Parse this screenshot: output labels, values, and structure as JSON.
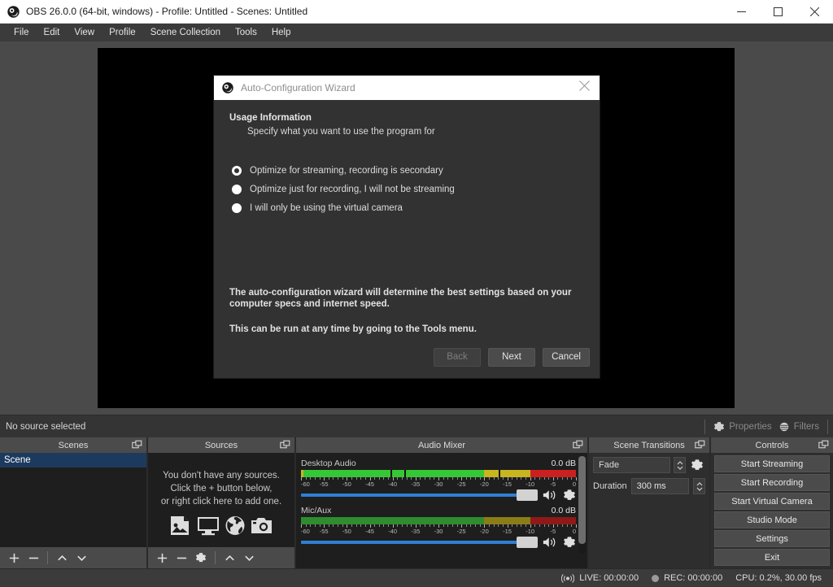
{
  "window": {
    "title": "OBS 26.0.0 (64-bit, windows) - Profile: Untitled - Scenes: Untitled",
    "minimize_label": "Minimize",
    "maximize_label": "Maximize",
    "close_label": "Close"
  },
  "menubar": {
    "items": [
      {
        "label": "File"
      },
      {
        "label": "Edit"
      },
      {
        "label": "View"
      },
      {
        "label": "Profile"
      },
      {
        "label": "Scene Collection"
      },
      {
        "label": "Tools"
      },
      {
        "label": "Help"
      }
    ]
  },
  "source_toolbar": {
    "status": "No source selected",
    "properties_label": "Properties",
    "filters_label": "Filters"
  },
  "scenes": {
    "title": "Scenes",
    "items": [
      {
        "name": "Scene",
        "selected": true
      }
    ]
  },
  "sources": {
    "title": "Sources",
    "empty_lines": [
      "You don't have any sources.",
      "Click the + button below,",
      "or right click here to add one."
    ]
  },
  "audio_mixer": {
    "title": "Audio Mixer",
    "tick_labels": [
      "-60",
      "-55",
      "-50",
      "-45",
      "-40",
      "-35",
      "-30",
      "-25",
      "-20",
      "-15",
      "-10",
      "-5",
      "0"
    ],
    "channels": [
      {
        "name": "Desktop Audio",
        "db": "0.0 dB",
        "active": true,
        "level_pct": 49,
        "peak_pct": 51,
        "volume_pct": 100
      },
      {
        "name": "Mic/Aux",
        "db": "0.0 dB",
        "active": false,
        "level_pct": 0,
        "peak_pct": 0,
        "volume_pct": 100
      }
    ]
  },
  "scene_transitions": {
    "title": "Scene Transitions",
    "transition": "Fade",
    "duration_label": "Duration",
    "duration_value": "300 ms"
  },
  "controls": {
    "title": "Controls",
    "buttons": [
      {
        "label": "Start Streaming"
      },
      {
        "label": "Start Recording"
      },
      {
        "label": "Start Virtual Camera"
      },
      {
        "label": "Studio Mode"
      },
      {
        "label": "Settings"
      },
      {
        "label": "Exit"
      }
    ]
  },
  "statusbar": {
    "live_label": "LIVE: 00:00:00",
    "rec_label": "REC: 00:00:00",
    "cpu_label": "CPU: 0.2%, 30.00 fps"
  },
  "wizard": {
    "title": "Auto-Configuration Wizard",
    "heading": "Usage Information",
    "subheading": "Specify what you want to use the program for",
    "options": [
      {
        "label": "Optimize for streaming, recording is secondary",
        "selected": true
      },
      {
        "label": "Optimize just for recording, I will not be streaming",
        "selected": false
      },
      {
        "label": "I will only be using the virtual camera",
        "selected": false
      }
    ],
    "paragraph1": "The auto-configuration wizard will determine the best settings based on your computer specs and internet speed.",
    "paragraph2": "This can be run at any time by going to the Tools menu.",
    "back_label": "Back",
    "next_label": "Next",
    "cancel_label": "Cancel",
    "back_disabled": true
  },
  "colors": {
    "accent_blue": "#2f7fd4",
    "selection_blue": "#1c3a5e",
    "meter_green": "#36c736",
    "meter_yellow": "#c8b520",
    "meter_red": "#cc2020"
  }
}
